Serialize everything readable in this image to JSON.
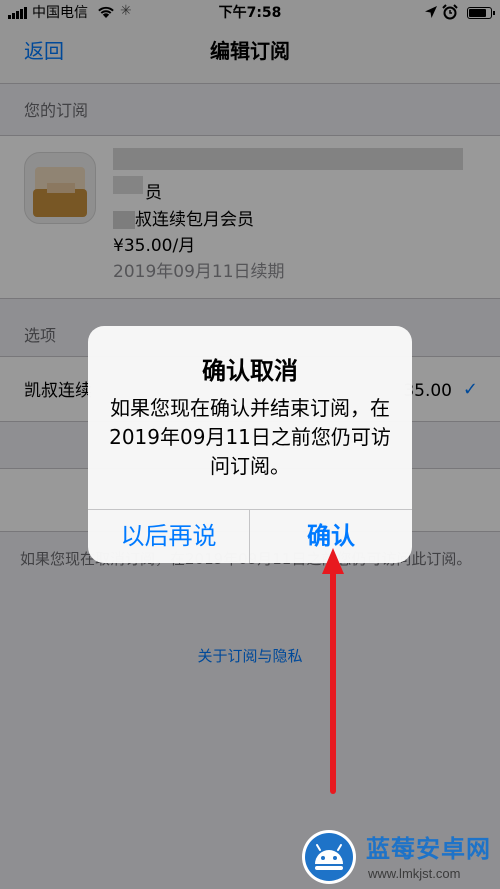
{
  "status_bar": {
    "carrier": "中国电信",
    "time": "下午7:58"
  },
  "nav": {
    "back": "返回",
    "title": "编辑订阅"
  },
  "subscription": {
    "section_header": "您的订阅",
    "name_partial": "员",
    "plan_partial": "叔连续包月会员",
    "price": "¥35.00/月",
    "renewal": "2019年09月11日续期"
  },
  "options": {
    "section_header": "选项",
    "option_label": "凯叔连续",
    "option_price": "35.00"
  },
  "footer": {
    "note": "如果您现在取消订阅，在2019年09月11日之前您仍可访问此订阅。",
    "privacy_link": "关于订阅与隐私"
  },
  "alert": {
    "title": "确认取消",
    "message": "如果您现在确认并结束订阅，在2019年09月11日之前您仍可访问订阅。",
    "cancel_label": "以后再说",
    "confirm_label": "确认"
  },
  "watermark": {
    "title": "蓝莓安卓网",
    "url": "www.lmkjst.com"
  },
  "colors": {
    "accent": "#007aff",
    "annotation": "#e8191f",
    "background": "#efeff4"
  }
}
